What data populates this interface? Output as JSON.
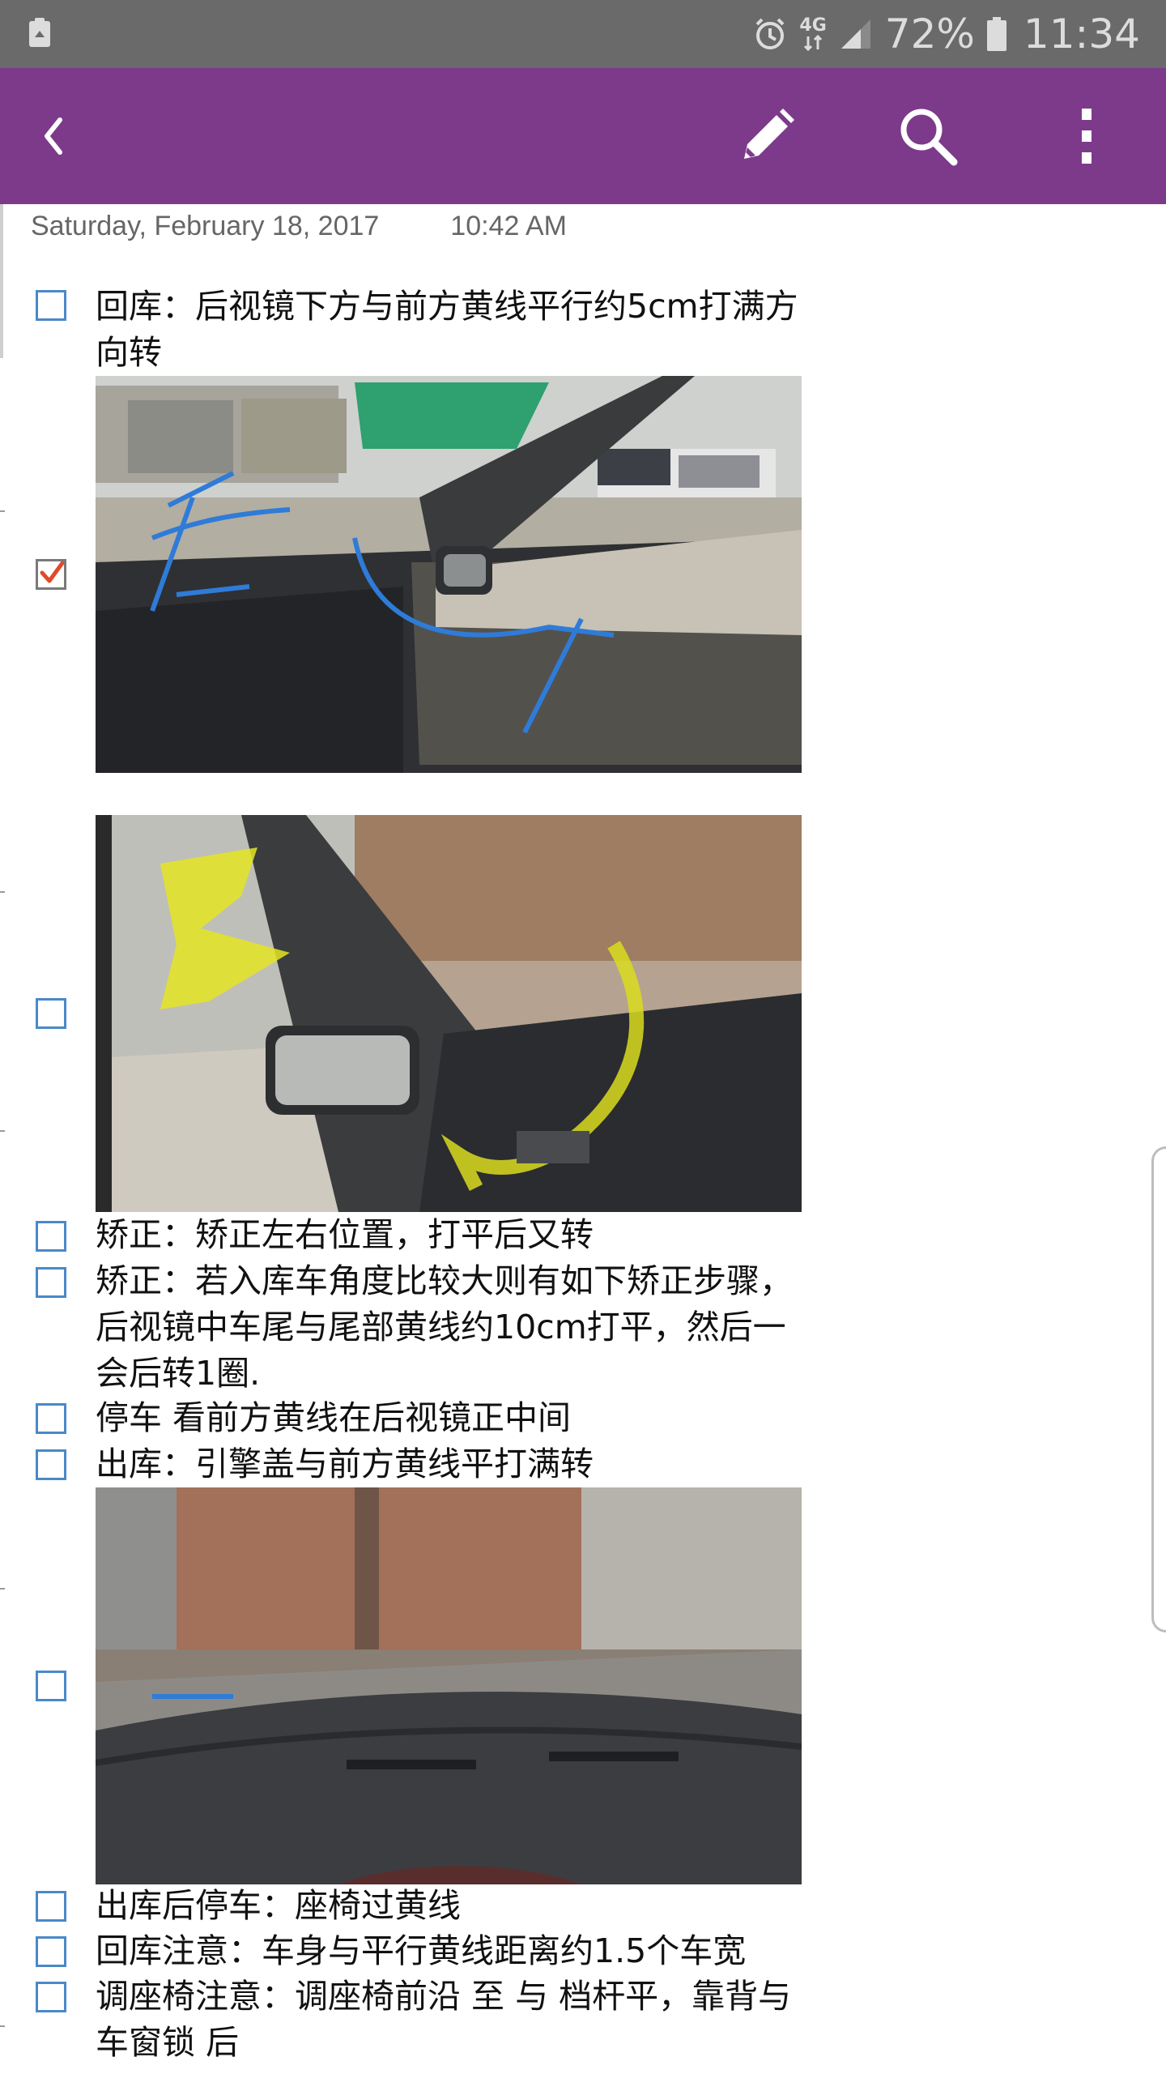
{
  "status_bar": {
    "network": "4G",
    "battery": "72%",
    "time": "11:34",
    "icons": [
      "recycle-icon",
      "alarm-icon",
      "network-4g-icon",
      "signal-icon",
      "battery-icon"
    ]
  },
  "app_bar": {
    "color": "#7d3a8b",
    "icons": [
      "back-icon",
      "edit-icon",
      "search-icon",
      "more-icon"
    ]
  },
  "note": {
    "date": "Saturday, February 18, 2017",
    "time": "10:42 AM",
    "items": [
      {
        "type": "todo",
        "checked": false,
        "text": "回库：后视镜下方与前方黄线平行约5cm打满方向转"
      },
      {
        "type": "image",
        "checked": true,
        "description": "car-interior-left-window"
      },
      {
        "type": "image",
        "checked": false,
        "description": "car-interior-left-mirror-yellow"
      },
      {
        "type": "todo",
        "checked": false,
        "text": "矫正：矫正左右位置，打平后又转"
      },
      {
        "type": "todo",
        "checked": false,
        "text": "矫正：若入库车角度比较大则有如下矫正步骤，后视镜中车尾与尾部黄线约10cm打平，然后一会后转1圈."
      },
      {
        "type": "todo",
        "checked": false,
        "text": "停车 看前方黄线在后视镜正中间"
      },
      {
        "type": "todo",
        "checked": false,
        "text": "出库：引擎盖与前方黄线平打满转"
      },
      {
        "type": "image",
        "checked": false,
        "description": "car-windshield-brick-wall"
      },
      {
        "type": "todo",
        "checked": false,
        "text": "出库后停车：座椅过黄线"
      },
      {
        "type": "todo",
        "checked": false,
        "text": "回库注意：车身与平行黄线距离约1.5个车宽"
      },
      {
        "type": "todo",
        "checked": false,
        "text": "调座椅注意：调座椅前沿 至 与 档杆平，靠背与车窗锁 后"
      }
    ]
  }
}
